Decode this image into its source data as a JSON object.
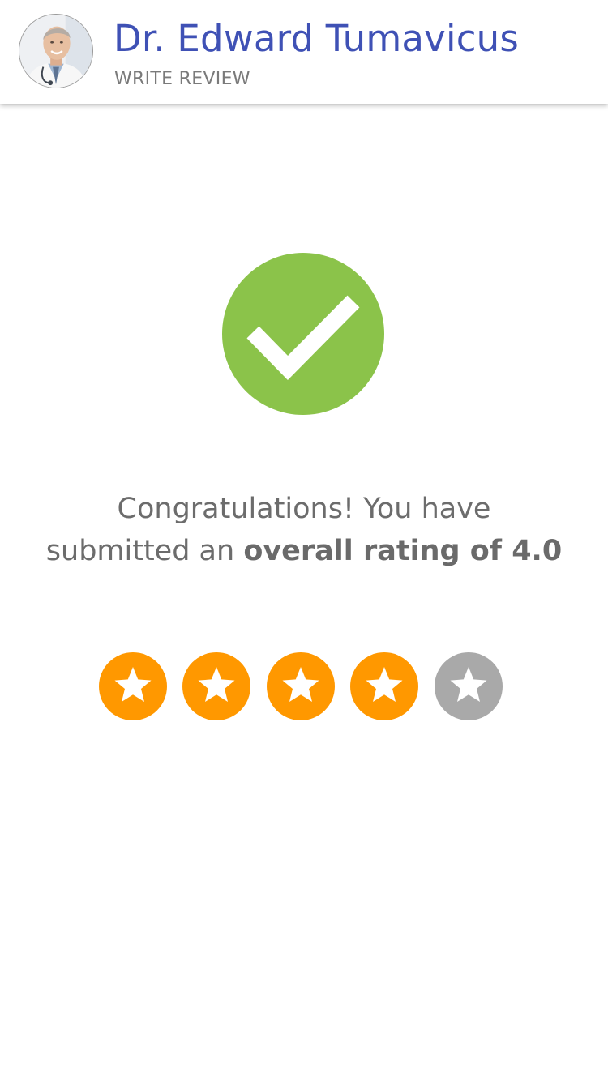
{
  "header": {
    "doctor_name": "Dr. Edward Tumavicus",
    "subtitle": "WRITE REVIEW",
    "avatar_icon": "doctor-avatar"
  },
  "confirmation": {
    "icon": "checkmark-icon",
    "line1": "Congratulations! You have",
    "line2_prefix": "submitted an ",
    "line2_emphasis": "overall rating of 4.0"
  },
  "rating": {
    "value": 4,
    "max": 5,
    "filled_icon": "star-filled-icon",
    "empty_icon": "star-empty-icon"
  },
  "colors": {
    "title": "#3f51b5",
    "success": "#8bc34a",
    "star_filled": "#ff9800",
    "star_empty": "#a9a9a9"
  }
}
